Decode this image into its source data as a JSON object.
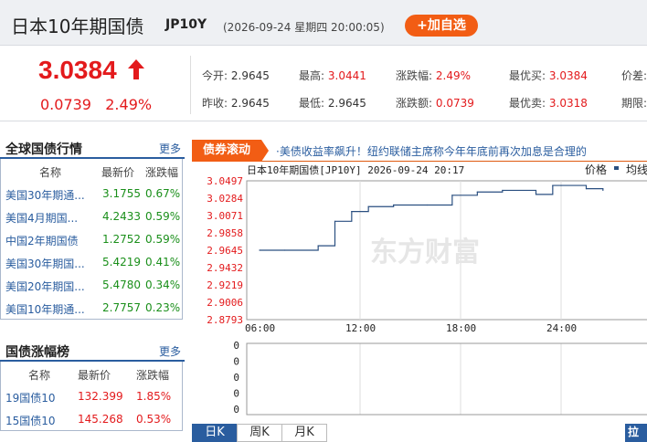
{
  "header": {
    "title": "日本10年期国债",
    "code": "JP10Y",
    "timestamp": "(2026-09-24 星期四 20:00:05)",
    "add_button": "+加自选"
  },
  "quote": {
    "price": "3.0384",
    "change": "0.0739",
    "change_pct": "2.49%",
    "fields": [
      {
        "label": "今开:",
        "value": "2.9645",
        "red": false
      },
      {
        "label": "最高:",
        "value": "3.0441",
        "red": true
      },
      {
        "label": "涨跌幅:",
        "value": "2.49%",
        "red": true
      },
      {
        "label": "最优买:",
        "value": "3.0384",
        "red": true
      },
      {
        "label": "价差:",
        "value": "",
        "red": false
      },
      {
        "label": "昨收:",
        "value": "2.9645",
        "red": false
      },
      {
        "label": "最低:",
        "value": "2.9645",
        "red": false
      },
      {
        "label": "涨跌额:",
        "value": "0.0739",
        "red": true
      },
      {
        "label": "最优卖:",
        "value": "3.0318",
        "red": true
      },
      {
        "label": "期限:",
        "value": "",
        "red": false
      }
    ]
  },
  "global_bonds": {
    "title": "全球国债行情",
    "more": "更多",
    "headers": [
      "名称",
      "最新价",
      "涨跌幅"
    ],
    "rows": [
      {
        "name": "美国30年期通...",
        "price": "3.1755",
        "pct": "0.67%"
      },
      {
        "name": "美国4月期国...",
        "price": "4.2433",
        "pct": "0.59%"
      },
      {
        "name": "中国2年期国债",
        "price": "1.2752",
        "pct": "0.59%"
      },
      {
        "name": "美国30年期国...",
        "price": "5.4219",
        "pct": "0.41%"
      },
      {
        "name": "美国20年期国...",
        "price": "5.4780",
        "pct": "0.34%"
      },
      {
        "name": "美国10年期通...",
        "price": "2.7757",
        "pct": "0.23%"
      }
    ]
  },
  "bond_gainers": {
    "title": "国债涨幅榜",
    "more": "更多",
    "headers": [
      "名称",
      "最新价",
      "涨跌幅"
    ],
    "rows": [
      {
        "name": "19国债10",
        "price": "132.399",
        "pct": "1.85%"
      },
      {
        "name": "15国债10",
        "price": "145.268",
        "pct": "0.53%"
      }
    ]
  },
  "news": {
    "tag": "债券滚动",
    "text": "·美债收益率飙升！纽约联储主席称今年年底前再次加息是合理的"
  },
  "chart_data": {
    "type": "line",
    "title": "日本10年期国债[JP10Y] 2026-09-24 20:17",
    "legend": [
      "价格",
      "均线"
    ],
    "yticks": [
      "3.0497",
      "3.0284",
      "3.0071",
      "2.9858",
      "2.9645",
      "2.9432",
      "2.9219",
      "2.9006",
      "2.8793"
    ],
    "xticks": [
      "06:00",
      "12:00",
      "18:00",
      "24:00",
      "06:00"
    ],
    "ylim": [
      2.8793,
      3.0497
    ],
    "x_hours": [
      0.0,
      1.5,
      3.5,
      4.5,
      5.5,
      6.5,
      8.0,
      10.0,
      11.5,
      13.0,
      14.5,
      16.5,
      17.5,
      18.0,
      19.5,
      20.5
    ],
    "values": [
      2.9645,
      2.9645,
      2.97,
      3.0,
      3.012,
      3.018,
      3.02,
      3.02,
      3.032,
      3.036,
      3.038,
      3.033,
      3.044,
      3.044,
      3.04,
      3.038
    ],
    "volume_yticks": [
      "0",
      "0",
      "0",
      "0",
      "0"
    ],
    "watermark": "东方财富"
  },
  "tabs": [
    "日K",
    "周K",
    "月K"
  ],
  "pull_button": "拉长",
  "colors": {
    "accent": "#f25d14",
    "up": "#e31a1c",
    "down": "#1a8f1a",
    "line": "#2a4f80",
    "link": "#2a5d9f"
  }
}
